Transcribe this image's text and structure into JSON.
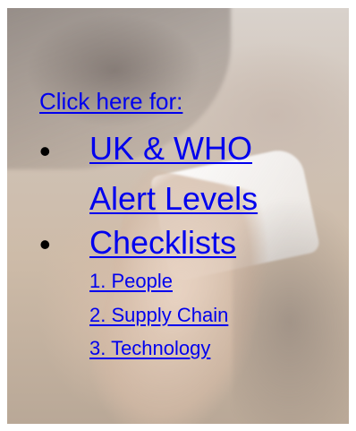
{
  "header": {
    "text": "Click here for:"
  },
  "items": [
    {
      "lines": [
        "UK & WHO",
        "Alert Levels"
      ]
    },
    {
      "label": "Checklists",
      "sub": [
        "1.  People",
        "2.  Supply Chain",
        "3.  Technology"
      ]
    }
  ],
  "colors": {
    "link": "#0000ee",
    "bullet": "#000000"
  }
}
